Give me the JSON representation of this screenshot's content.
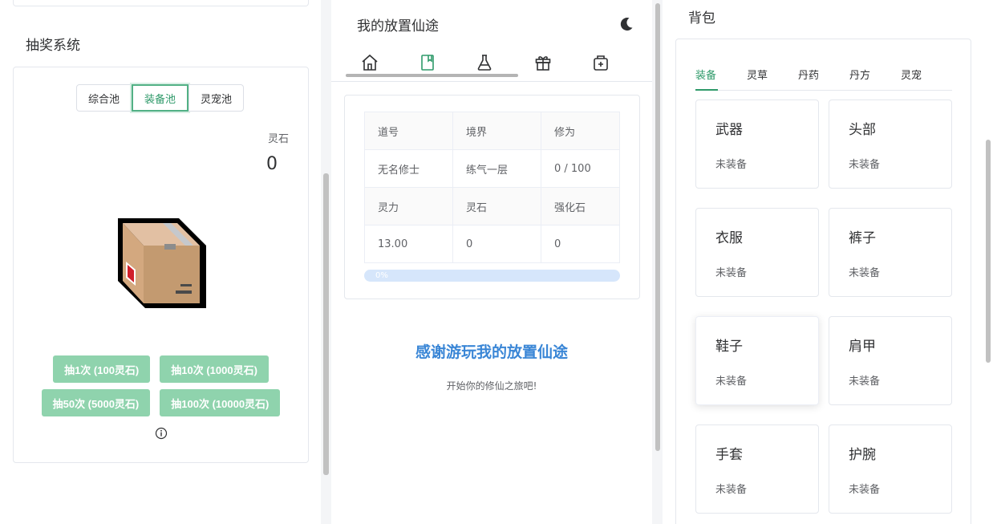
{
  "lottery": {
    "title": "抽奖系统",
    "pools": [
      "综合池",
      "装备池",
      "灵宠池"
    ],
    "active_pool": "装备池",
    "stone_label": "灵石",
    "stone_value": "0",
    "draw_buttons": [
      "抽1次 (100灵石)",
      "抽10次 (1000灵石)",
      "抽50次 (5000灵石)",
      "抽100次 (10000灵石)"
    ],
    "info_icon": "info-icon"
  },
  "main": {
    "title": "我的放置仙途",
    "theme_icon": "moon-icon",
    "nav_icons": [
      "home-icon",
      "book-icon",
      "flask-icon",
      "gift-icon",
      "medkit-icon"
    ],
    "active_nav": "book-icon",
    "stats": {
      "headers1": [
        "道号",
        "境界",
        "修为"
      ],
      "values1": [
        "无名修士",
        "练气一层",
        "0 / 100"
      ],
      "headers2": [
        "灵力",
        "灵石",
        "强化石"
      ],
      "values2": [
        "13.00",
        "0",
        "0"
      ]
    },
    "progress_label": "0%",
    "progress": 0,
    "thanks_title": "感谢游玩我的放置仙途",
    "thanks_sub": "开始你的修仙之旅吧!"
  },
  "bag": {
    "title": "背包",
    "tabs": [
      "装备",
      "灵草",
      "丹药",
      "丹方",
      "灵宠"
    ],
    "active_tab": "装备",
    "slots": [
      {
        "name": "武器",
        "state": "未装备"
      },
      {
        "name": "头部",
        "state": "未装备"
      },
      {
        "name": "衣服",
        "state": "未装备"
      },
      {
        "name": "裤子",
        "state": "未装备"
      },
      {
        "name": "鞋子",
        "state": "未装备"
      },
      {
        "name": "肩甲",
        "state": "未装备"
      },
      {
        "name": "手套",
        "state": "未装备"
      },
      {
        "name": "护腕",
        "state": "未装备"
      }
    ]
  },
  "colors": {
    "accent": "#2f9a6a",
    "draw_button": "#8fd3ad",
    "link_blue": "#3a86d6",
    "progress_bg": "#d6e6fb"
  }
}
